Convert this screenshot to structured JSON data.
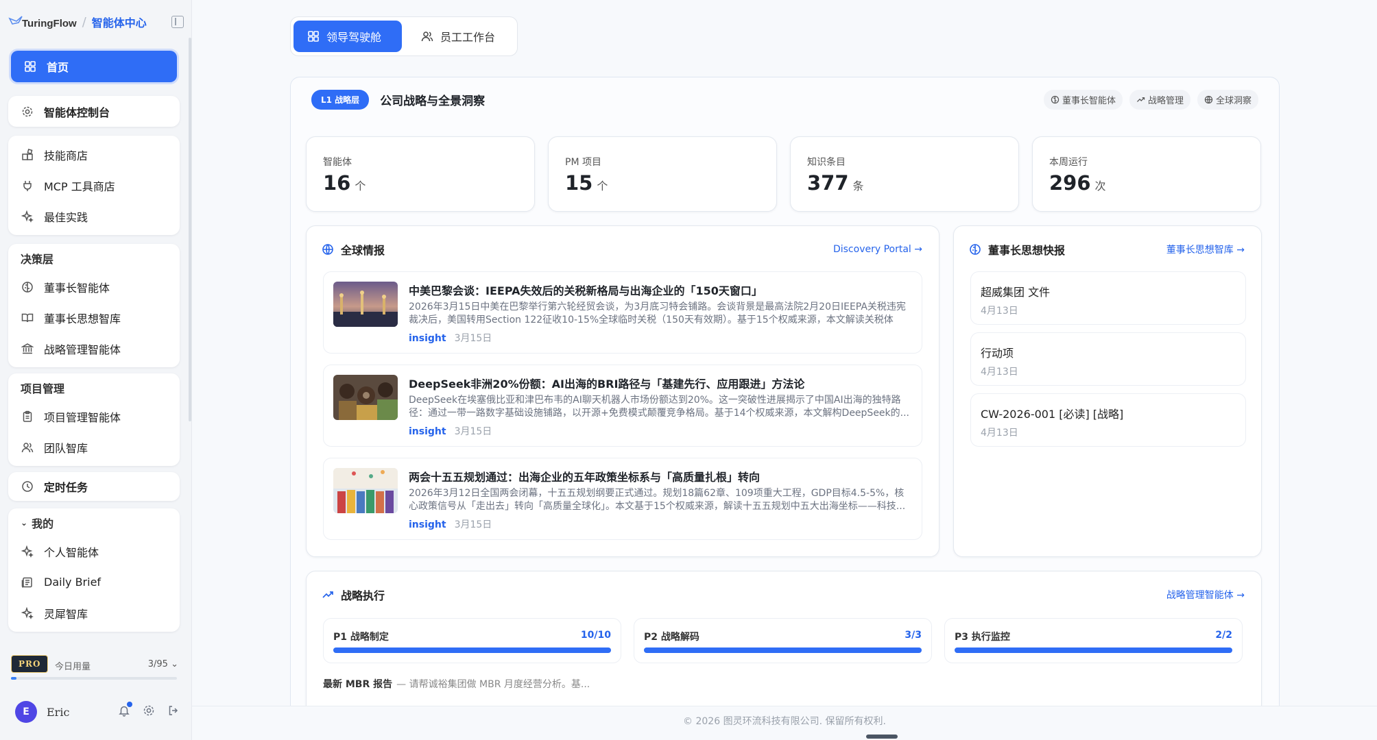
{
  "sidebar": {
    "logo_text": "TuringFlow",
    "section_title": "智能体中心",
    "home": "首页",
    "console": "智能体控制台",
    "tools": [
      "技能商店",
      "MCP 工具商店",
      "最佳实践"
    ],
    "decision_group": {
      "label": "决策层",
      "items": [
        "董事长智能体",
        "董事长思想智库",
        "战略管理智能体"
      ]
    },
    "project_group": {
      "label": "项目管理",
      "items": [
        "项目管理智能体",
        "团队智库"
      ]
    },
    "scheduled": "定时任务",
    "mine_group": {
      "label": "我的",
      "items": [
        "个人智能体",
        "Daily Brief",
        "灵犀智库"
      ]
    },
    "usage": {
      "plan": "PRO",
      "label": "今日用量",
      "count": "3/95",
      "fraction": 0.032
    },
    "user": {
      "initial": "E",
      "name": "Eric"
    }
  },
  "mode_switch": {
    "leader": "领导驾驶舱",
    "staff": "员工工作台"
  },
  "panel": {
    "badge": "L1 战略层",
    "title": "公司战略与全景洞察",
    "chips": [
      "董事长智能体",
      "战略管理",
      "全球洞察"
    ],
    "stats": [
      {
        "label": "智能体",
        "value": "16",
        "unit": "个"
      },
      {
        "label": "PM 项目",
        "value": "15",
        "unit": "个"
      },
      {
        "label": "知识条目",
        "value": "377",
        "unit": "条"
      },
      {
        "label": "本周运行",
        "value": "296",
        "unit": "次"
      }
    ],
    "global": {
      "title": "全球情报",
      "link": "Discovery Portal →",
      "items": [
        {
          "title": "中美巴黎会谈：IEEPA失效后的关税新格局与出海企业的「150天窗口」",
          "desc": "2026年3月15日中美在巴黎举行第六轮经贸会谈，为3月底习特会铺路。会谈背景是最高法院2月20日IEEPA关税违宪裁决后，美国转用Section 122征收10-15%全球临时关税（150天有效期）。基于15个权威来源，本文解读关税体系...",
          "tag": "insight",
          "date": "3月15日"
        },
        {
          "title": "DeepSeek非洲20%份额：AI出海的BRI路径与「基建先行、应用跟进」方法论",
          "desc": "DeepSeek在埃塞俄比亚和津巴布韦的AI聊天机器人市场份额达到20%。这一突破性进展揭示了中国AI出海的独特路径：通过一带一路数字基础设施铺路，以开源+免费模式颠覆竞争格局。基于14个权威来源，本文解构DeepSeek的...",
          "tag": "insight",
          "date": "3月15日"
        },
        {
          "title": "两会十五五规划通过：出海企业的五年政策坐标系与「高质量扎根」转向",
          "desc": "2026年3月12日全国两会闭幕，十五五规划纲要正式通过。规划18篇62章、109项重大工程，GDP目标4.5-5%，核心政策信号从「走出去」转向「高质量全球化」。本文基于15个权威来源，解读十五五规划中五大出海坐标——科技...",
          "tag": "insight",
          "date": "3月15日"
        }
      ]
    },
    "chairman": {
      "title": "董事长思想快报",
      "link": "董事长思想智库 →",
      "items": [
        {
          "title": "超威集团 文件",
          "date": "4月13日"
        },
        {
          "title": "行动项",
          "date": "4月13日"
        },
        {
          "title": "CW-2026-001 [必读] [战略]",
          "date": "4月13日"
        }
      ]
    },
    "strategy": {
      "title": "战略执行",
      "link": "战略管理智能体 →",
      "phases": [
        {
          "name": "P1 战略制定",
          "count": "10/10",
          "progress": 1.0
        },
        {
          "name": "P2 战略解码",
          "count": "3/3",
          "progress": 1.0
        },
        {
          "name": "P3 执行监控",
          "count": "2/2",
          "progress": 1.0
        }
      ],
      "mbr_label": "最新 MBR 报告",
      "mbr_text": "— 请帮诚裕集团做 MBR 月度经营分析。基..."
    }
  },
  "footer": "© 2026 图灵环流科技有限公司. 保留所有权利."
}
